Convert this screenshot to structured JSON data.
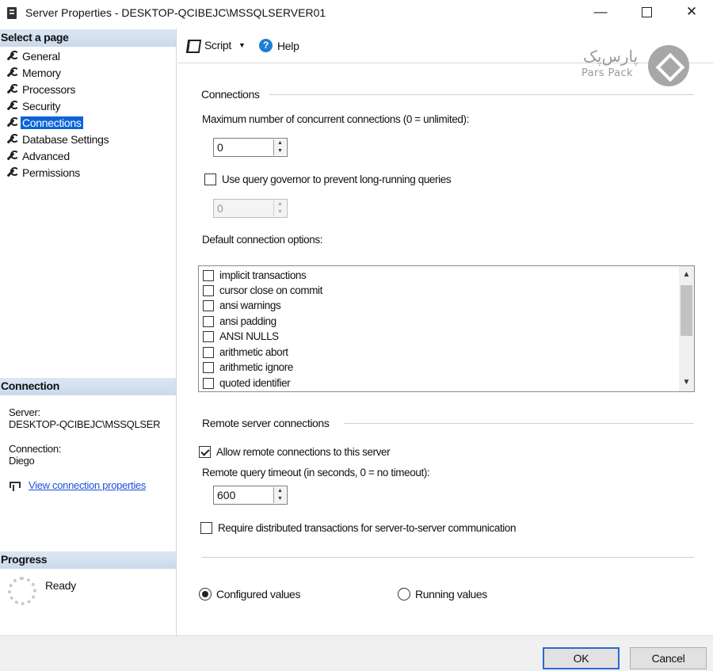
{
  "window": {
    "title": "Server Properties - DESKTOP-QCIBEJC\\MSSQLSERVER01",
    "minimize": "—",
    "close": "✕"
  },
  "left_pane": {
    "select_page_header": "Select a page",
    "pages": [
      {
        "label": "General",
        "selected": false
      },
      {
        "label": "Memory",
        "selected": false
      },
      {
        "label": "Processors",
        "selected": false
      },
      {
        "label": "Security",
        "selected": false
      },
      {
        "label": "Connections",
        "selected": true
      },
      {
        "label": "Database Settings",
        "selected": false
      },
      {
        "label": "Advanced",
        "selected": false
      },
      {
        "label": "Permissions",
        "selected": false
      }
    ],
    "connection_header": "Connection",
    "server_label": "Server:",
    "server_value": "DESKTOP-QCIBEJC\\MSSQLSER",
    "connection_label": "Connection:",
    "connection_value": "Diego",
    "view_connection_link": "View connection properties",
    "progress_header": "Progress",
    "progress_status": "Ready"
  },
  "toolbar": {
    "script_label": "Script",
    "help_label": "Help"
  },
  "logo": {
    "farsi_text": "پارس‌پک",
    "english_text": "Pars Pack"
  },
  "connections": {
    "group_title": "Connections",
    "max_concurrent_label": "Maximum number of concurrent connections (0 = unlimited):",
    "max_concurrent_value": "0",
    "query_governor_label": "Use query governor to prevent long-running queries",
    "query_governor_checked": false,
    "query_governor_value": "0",
    "default_options_label": "Default connection options:",
    "default_options": [
      {
        "label": "implicit transactions",
        "checked": false
      },
      {
        "label": "cursor close on commit",
        "checked": false
      },
      {
        "label": "ansi warnings",
        "checked": false
      },
      {
        "label": "ansi padding",
        "checked": false
      },
      {
        "label": "ANSI NULLS",
        "checked": false
      },
      {
        "label": "arithmetic abort",
        "checked": false
      },
      {
        "label": "arithmetic ignore",
        "checked": false
      },
      {
        "label": "quoted identifier",
        "checked": false
      }
    ]
  },
  "remote": {
    "group_title": "Remote server connections",
    "allow_remote_label": "Allow remote connections to this server",
    "allow_remote_checked": true,
    "timeout_label": "Remote query timeout (in seconds, 0 = no timeout):",
    "timeout_value": "600",
    "distributed_label": "Require distributed transactions for server-to-server communication",
    "distributed_checked": false
  },
  "values_mode": {
    "configured_label": "Configured values",
    "running_label": "Running values",
    "selected": "configured"
  },
  "buttons": {
    "ok": "OK",
    "cancel": "Cancel"
  }
}
